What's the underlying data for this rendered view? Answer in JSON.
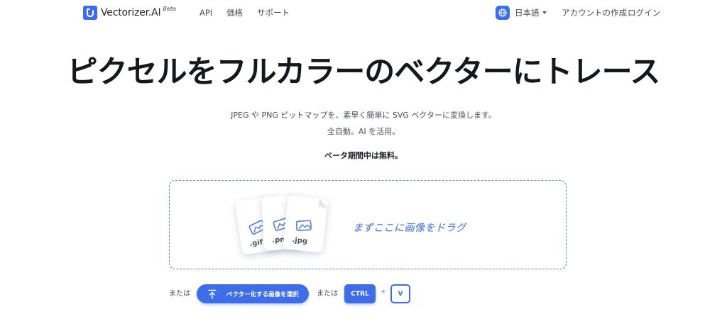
{
  "brand": {
    "name": "Vectorizer.AI",
    "badge": "Beta",
    "accent": "#3d6de8"
  },
  "nav": {
    "api": "API",
    "pricing": "価格",
    "support": "サポート",
    "language": "日本語",
    "create_account": "アカウントの作成",
    "login": "ログイン"
  },
  "hero": {
    "title": "ピクセルをフルカラーのベクターにトレース",
    "subtitle_1": "JPEG や PNG ビットマップを、素早く簡単に SVG ベクターに変換します。",
    "subtitle_2": "全自動。AI を活用。",
    "free_note": "ベータ期間中は無料。"
  },
  "dropzone": {
    "prompt": "まずここに画像をドラグ",
    "file_types": [
      ".gif",
      ".png",
      ".jpg"
    ]
  },
  "actions": {
    "or_1": "または",
    "upload_label": "ベクター化する画像を選択",
    "or_2": "または",
    "key_ctrl": "CTRL",
    "plus": "+",
    "key_v": "V"
  },
  "icons": {
    "logo": "vectorizer-logo-icon",
    "language": "globe-icon",
    "upload": "upload-arrow-icon",
    "file": "image-file-icon"
  }
}
